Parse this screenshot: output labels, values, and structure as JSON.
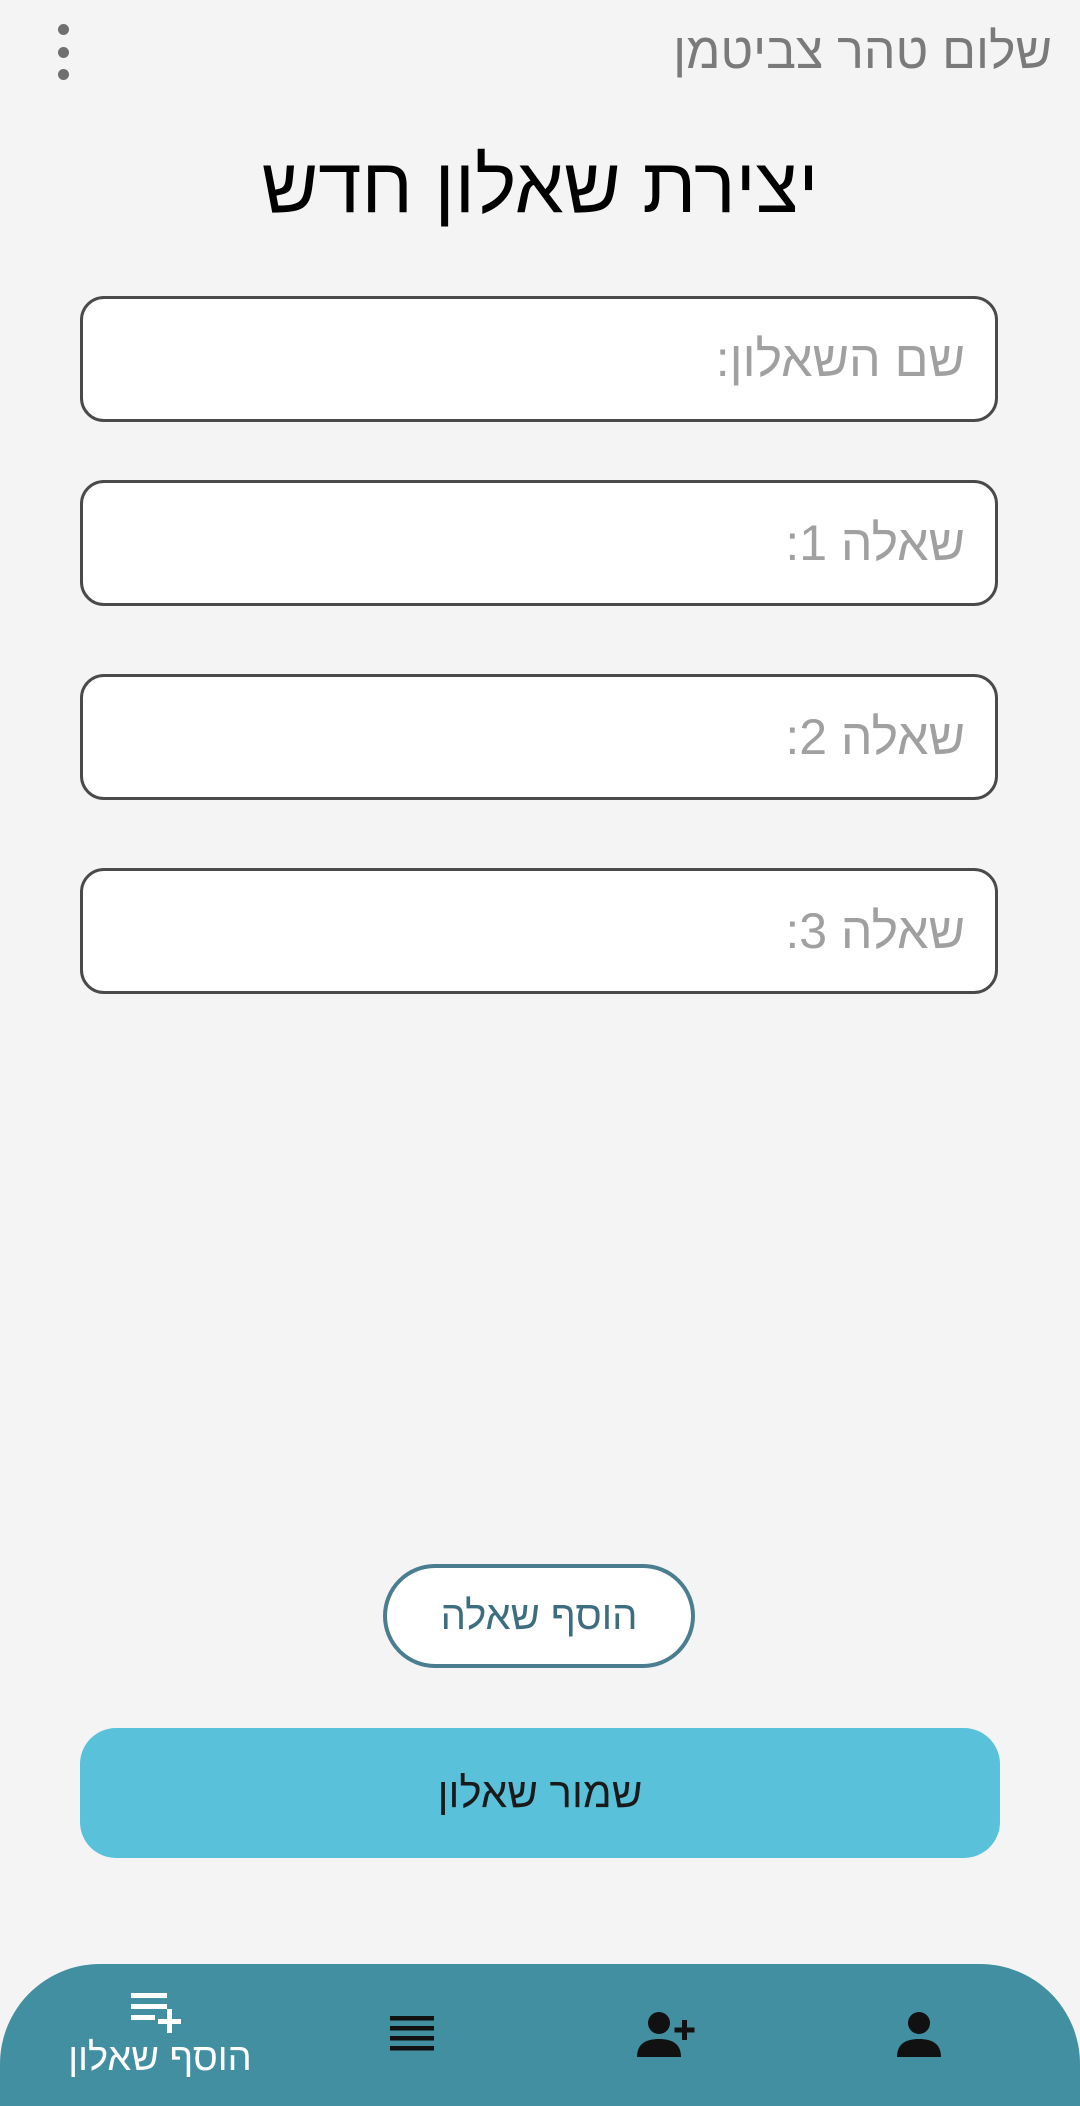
{
  "header": {
    "greeting": "שלום טהר צביטמן",
    "menu_icon": "more-vertical-icon"
  },
  "page": {
    "title": "יצירת שאלון חדש"
  },
  "form": {
    "name_placeholder": "שם השאלון:",
    "questions": [
      {
        "placeholder": "שאלה 1:"
      },
      {
        "placeholder": "שאלה 2:"
      },
      {
        "placeholder": "שאלה 3:"
      }
    ],
    "add_question_label": "הוסף שאלה",
    "save_label": "שמור שאלון"
  },
  "bottom_nav": {
    "items": [
      {
        "icon": "playlist-add-icon",
        "label": "הוסף שאלון",
        "active": true
      },
      {
        "icon": "list-icon",
        "label": ""
      },
      {
        "icon": "person-add-icon",
        "label": ""
      },
      {
        "icon": "person-icon",
        "label": ""
      }
    ]
  },
  "colors": {
    "background": "#f4f4f4",
    "nav_background": "#418fa1",
    "save_button": "#59c2da",
    "outline_button_border": "#4a7d8f"
  }
}
